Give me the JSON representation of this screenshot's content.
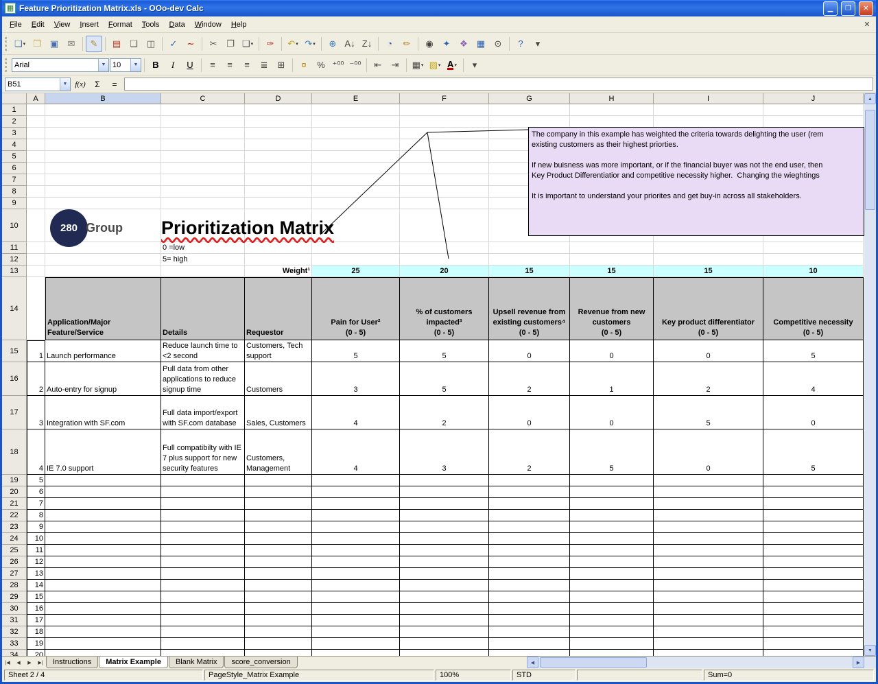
{
  "window": {
    "title": "Feature Prioritization Matrix.xls - OOo-dev Calc"
  },
  "menu": {
    "items": [
      "File",
      "Edit",
      "View",
      "Insert",
      "Format",
      "Tools",
      "Data",
      "Window",
      "Help"
    ]
  },
  "toolbar_standard": [
    {
      "name": "new-document",
      "glyph": "❏",
      "color": "#4a6ea9",
      "dd": true
    },
    {
      "name": "open-folder",
      "glyph": "❒",
      "color": "#caa64f"
    },
    {
      "name": "save",
      "glyph": "▣",
      "color": "#4a6ea9"
    },
    {
      "name": "email",
      "glyph": "✉",
      "color": "#777777"
    },
    {
      "sep": true
    },
    {
      "name": "edit-file",
      "glyph": "✎",
      "color": "#b28a2e",
      "active": true
    },
    {
      "sep": true
    },
    {
      "name": "export-pdf",
      "glyph": "▤",
      "color": "#c0392b"
    },
    {
      "name": "print",
      "glyph": "❑",
      "color": "#555555"
    },
    {
      "name": "page-preview",
      "glyph": "◫",
      "color": "#555555"
    },
    {
      "sep": true
    },
    {
      "name": "spellcheck",
      "glyph": "✓",
      "color": "#2e63b0"
    },
    {
      "name": "auto-spellcheck",
      "glyph": "∼",
      "color": "#c00000"
    },
    {
      "sep": true
    },
    {
      "name": "cut",
      "glyph": "✂",
      "color": "#555555"
    },
    {
      "name": "copy",
      "glyph": "❐",
      "color": "#555555"
    },
    {
      "name": "paste",
      "glyph": "❏",
      "color": "#555555",
      "dd": true
    },
    {
      "sep": true
    },
    {
      "name": "format-paintbrush",
      "glyph": "✑",
      "color": "#b23030"
    },
    {
      "sep": true
    },
    {
      "name": "undo",
      "glyph": "↶",
      "color": "#c9a227",
      "dd": true
    },
    {
      "name": "redo",
      "glyph": "↷",
      "color": "#3a7ebf",
      "dd": true
    },
    {
      "sep": true
    },
    {
      "name": "hyperlink",
      "glyph": "⊕",
      "color": "#3a7ebf"
    },
    {
      "name": "sort-ascending",
      "glyph": "A↓",
      "color": "#444444"
    },
    {
      "name": "sort-descending",
      "glyph": "Z↓",
      "color": "#444444"
    },
    {
      "sep": true
    },
    {
      "name": "insert-chart",
      "glyph": "◔",
      "color": "#2e63b0"
    },
    {
      "name": "draw-functions",
      "glyph": "✏",
      "color": "#b28a2e"
    },
    {
      "sep": true
    },
    {
      "name": "find-replace",
      "glyph": "◉",
      "color": "#444444"
    },
    {
      "name": "navigator",
      "glyph": "✦",
      "color": "#2e63b0"
    },
    {
      "name": "gallery",
      "glyph": "❖",
      "color": "#8a5fb0"
    },
    {
      "name": "data-sources",
      "glyph": "▦",
      "color": "#2e63b0"
    },
    {
      "name": "zoom",
      "glyph": "⊙",
      "color": "#444444"
    },
    {
      "sep": true
    },
    {
      "name": "help",
      "glyph": "?",
      "color": "#2e63b0"
    },
    {
      "name": "toolbar-options",
      "glyph": "▾",
      "color": "#444444"
    }
  ],
  "toolbar_formatting": {
    "font_name": "Arial",
    "font_size": "10",
    "buttons": [
      {
        "name": "bold",
        "glyph": "B",
        "cls": "bold"
      },
      {
        "name": "italic",
        "glyph": "I",
        "cls": "ital"
      },
      {
        "name": "underline",
        "glyph": "U",
        "cls": "und"
      },
      {
        "sep": true
      },
      {
        "name": "align-left",
        "glyph": "≡",
        "color": "#444444"
      },
      {
        "name": "align-center",
        "glyph": "≡",
        "color": "#444444"
      },
      {
        "name": "align-right",
        "glyph": "≡",
        "color": "#444444"
      },
      {
        "name": "align-justified",
        "glyph": "≣",
        "color": "#444444"
      },
      {
        "name": "merge-cells",
        "glyph": "⊞",
        "color": "#444444"
      },
      {
        "sep": true
      },
      {
        "name": "number-format-currency",
        "glyph": "¤",
        "color": "#b8860b"
      },
      {
        "name": "number-format-percent",
        "glyph": "%",
        "color": "#444444"
      },
      {
        "name": "number-format-add-decimal",
        "glyph": "⁺⁰⁰",
        "color": "#444444"
      },
      {
        "name": "number-format-delete-decimal",
        "glyph": "⁻⁰⁰",
        "color": "#444444"
      },
      {
        "sep": true
      },
      {
        "name": "decrease-indent",
        "glyph": "⇤",
        "color": "#444444"
      },
      {
        "name": "increase-indent",
        "glyph": "⇥",
        "color": "#444444"
      },
      {
        "sep": true
      },
      {
        "name": "borders",
        "glyph": "▦",
        "color": "#444444",
        "dd": true
      },
      {
        "name": "background-color",
        "glyph": "▨",
        "color": "#c8a200",
        "dd": true
      },
      {
        "name": "font-color",
        "glyph": "A",
        "cls": "fontcol",
        "dd": true
      },
      {
        "sep": true
      },
      {
        "name": "toolbar-options",
        "glyph": "▾",
        "color": "#444444"
      }
    ]
  },
  "formula_bar": {
    "cell_ref": "B51",
    "buttons": {
      "wizard": "f(x)",
      "sum": "Σ",
      "formula": "="
    },
    "input_value": ""
  },
  "grid": {
    "columns": [
      "A",
      "B",
      "C",
      "D",
      "E",
      "F",
      "G",
      "H",
      "I",
      "J"
    ],
    "selected_column": "B",
    "first_row": 1,
    "last_row": 34
  },
  "logo": {
    "circle_text": "280",
    "suffix": "Group"
  },
  "comment": {
    "lines": [
      "The company in this example has weighted the criteria towards delighting the user (rem",
      "existing customers as their highest priorties.",
      "",
      "If new buisness was more important, or if the financial buyer was not the end user, then",
      "Key Product Differentiatior and competitive necessity higher.  Changing the wieghtings ",
      "",
      "It is important to understand your priorites and get buy-in across all stakeholders."
    ]
  },
  "content": {
    "title": "Prioritization Matrix",
    "legend_low": "0 =low",
    "legend_high": "5= high",
    "weight_label": "Weight¹",
    "weights": [
      "25",
      "20",
      "15",
      "15",
      "15",
      "10"
    ],
    "table": {
      "headers": {
        "feature": "Application/Major Feature/Service",
        "details": "Details",
        "requestor": "Requestor",
        "score_columns": [
          {
            "title": "Pain for User²",
            "scale": "(0 - 5)"
          },
          {
            "title": "% of customers impacted³",
            "scale": "(0 - 5)"
          },
          {
            "title": "Upsell revenue from existing customers⁴",
            "scale": "(0 - 5)"
          },
          {
            "title": "Revenue from new customers",
            "scale": "(0 - 5)"
          },
          {
            "title": "Key product differentiator",
            "scale": "(0 - 5)"
          },
          {
            "title": "Competitive necessity",
            "scale": "(0 - 5)"
          }
        ]
      },
      "rows": [
        {
          "num": "1",
          "feature": "Launch performance",
          "details": "Reduce launch time to <2 second",
          "requestor": "Customers, Tech support",
          "scores": [
            "5",
            "5",
            "0",
            "0",
            "0",
            "5"
          ]
        },
        {
          "num": "2",
          "feature": "Auto-entry for signup",
          "details": "Pull data from other applications to reduce signup time",
          "requestor": "Customers",
          "scores": [
            "3",
            "5",
            "2",
            "1",
            "2",
            "4"
          ]
        },
        {
          "num": "3",
          "feature": "Integration with SF.com",
          "details": "Full data import/export with SF.com database",
          "requestor": "Sales, Customers",
          "scores": [
            "4",
            "2",
            "0",
            "0",
            "5",
            "0"
          ]
        },
        {
          "num": "4",
          "feature": "IE 7.0 support",
          "details": "Full compatibilty with IE 7 plus support for new security features",
          "requestor": "Customers, Management",
          "scores": [
            "4",
            "3",
            "2",
            "5",
            "0",
            "5"
          ]
        }
      ],
      "empty_row_numbers": [
        "5",
        "6",
        "7",
        "8",
        "9",
        "10",
        "11",
        "12",
        "13",
        "14",
        "15",
        "16",
        "17",
        "18",
        "19",
        "20"
      ]
    }
  },
  "sheet_tabs": {
    "nav": [
      {
        "name": "first-sheet",
        "glyph": "|◀"
      },
      {
        "name": "previous-sheet",
        "glyph": "◀"
      },
      {
        "name": "next-sheet",
        "glyph": "▶"
      },
      {
        "name": "last-sheet",
        "glyph": "▶|"
      }
    ],
    "tabs": [
      {
        "label": "Instructions"
      },
      {
        "label": "Matrix Example",
        "active": true
      },
      {
        "label": "Blank Matrix"
      },
      {
        "label": "score_conversion"
      }
    ]
  },
  "status_bar": {
    "segments": [
      "Sheet 2 / 4",
      "PageStyle_Matrix Example",
      "100%",
      "STD",
      "",
      "Sum=0"
    ]
  }
}
